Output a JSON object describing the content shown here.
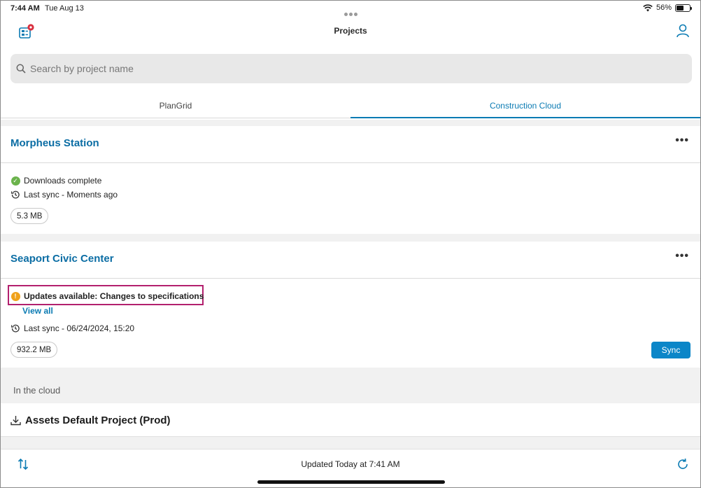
{
  "status": {
    "time": "7:44 AM",
    "date": "Tue Aug 13",
    "battery": "56%",
    "battery_level": 0.56
  },
  "header": {
    "title": "Projects",
    "left_icon": "notifications-list-icon",
    "right_icon": "user-icon"
  },
  "search": {
    "placeholder": "Search by project name",
    "value": ""
  },
  "tabs": [
    {
      "label": "PlanGrid",
      "active": false
    },
    {
      "label": "Construction Cloud",
      "active": true
    }
  ],
  "projects": [
    {
      "name": "Morpheus Station",
      "status": "Downloads complete",
      "last_sync": "Last sync - Moments ago",
      "size": "5.3 MB"
    },
    {
      "name": "Seaport Civic Center",
      "status": "Updates available: Changes to specifications",
      "view_all": "View all",
      "last_sync": "Last sync - 06/24/2024, 15:20",
      "size": "932.2 MB",
      "sync_label": "Sync"
    }
  ],
  "cloud": {
    "section_label": "In the cloud",
    "items": [
      {
        "name": "Assets Default Project (Prod)"
      }
    ]
  },
  "footer": {
    "updated_text": "Updated Today at 7:41 AM"
  },
  "colors": {
    "accent": "#0b7bb3",
    "highlight": "#b3206e",
    "success": "#6bb34c",
    "warning": "#f0a21b"
  }
}
